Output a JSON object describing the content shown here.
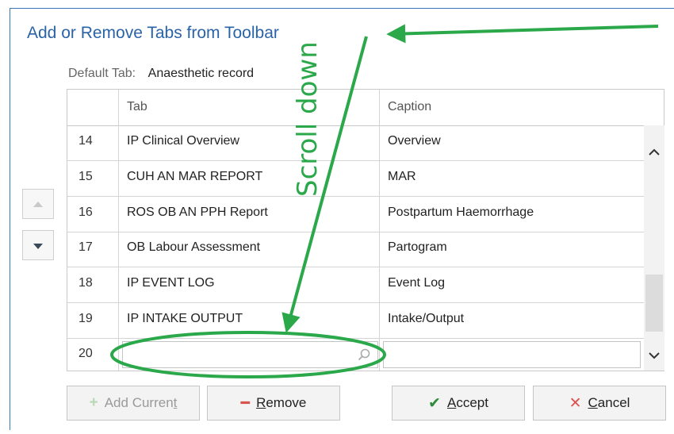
{
  "dialog": {
    "title": "Add or Remove Tabs from Toolbar",
    "default_tab_label": "Default Tab:",
    "default_tab_value": "Anaesthetic record"
  },
  "grid": {
    "columns": [
      "Tab",
      "Caption"
    ],
    "rows": [
      {
        "num": "14",
        "tab": "IP Clinical Overview",
        "caption": "Overview"
      },
      {
        "num": "15",
        "tab": "CUH AN MAR REPORT",
        "caption": "MAR"
      },
      {
        "num": "16",
        "tab": "ROS OB AN PPH Report",
        "caption": "Postpartum Haemorrhage"
      },
      {
        "num": "17",
        "tab": "OB Labour Assessment",
        "caption": "Partogram"
      },
      {
        "num": "18",
        "tab": "IP EVENT LOG",
        "caption": "Event Log"
      },
      {
        "num": "19",
        "tab": "IP INTAKE OUTPUT",
        "caption": "Intake/Output"
      }
    ],
    "edit_row": {
      "num": "20",
      "tab_value": "",
      "caption_value": ""
    }
  },
  "buttons": {
    "add_current_pre": "Add Curren",
    "add_current_u": "t",
    "remove_u": "R",
    "remove_post": "emove",
    "accept_u": "A",
    "accept_post": "ccept",
    "cancel_u": "C",
    "cancel_post": "ancel"
  },
  "annotation": {
    "text": "Scroll down",
    "color": "#2aa84a"
  },
  "colors": {
    "title": "#2a63a8",
    "accent_green": "#2aa84a",
    "remove_red": "#d9534f",
    "cancel_red": "#d9534f"
  }
}
